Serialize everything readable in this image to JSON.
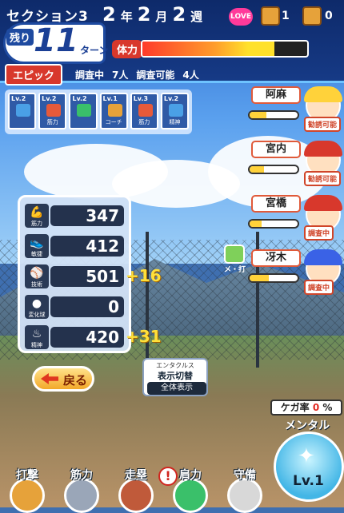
{
  "header": {
    "section": "セクション3",
    "year": "2",
    "year_unit": "年",
    "month": "2",
    "month_unit": "月",
    "week": "2",
    "week_unit": "週",
    "love_badge": "LOVE",
    "chest_1_count": "1",
    "chest_2_count": "0",
    "remaining_label": "残り",
    "turns_value": "11",
    "turns_unit": "ターン",
    "stamina_label": "体力",
    "stamina_fraction": 0.8,
    "epic_label": "エピック",
    "investigating_label": "調査中",
    "investigating_count": "7人",
    "investigatable_label": "調査可能",
    "investigatable_count": "4人"
  },
  "cards": [
    {
      "lv": "Lv.2",
      "name": "",
      "color": "#4aa0e6"
    },
    {
      "lv": "Lv.2",
      "name": "筋力",
      "color": "#e65a3a"
    },
    {
      "lv": "Lv.2",
      "name": "",
      "color": "#3ac06a"
    },
    {
      "lv": "Lv.1",
      "name": "コーチ",
      "color": "#e6a23a"
    },
    {
      "lv": "Lv.3",
      "name": "筋力",
      "color": "#e65a3a"
    },
    {
      "lv": "Lv.2",
      "name": "精神",
      "color": "#4aa0e6"
    }
  ],
  "stats": [
    {
      "icon": "muscle-icon",
      "label": "筋力",
      "value": "347",
      "plus": ""
    },
    {
      "icon": "shoe-icon",
      "label": "敏捷",
      "value": "412",
      "plus": ""
    },
    {
      "icon": "bat-icon",
      "label": "技術",
      "value": "501",
      "plus": "+16"
    },
    {
      "icon": "ball-icon",
      "label": "変化球",
      "value": "0",
      "plus": ""
    },
    {
      "icon": "flame-icon",
      "label": "精神",
      "value": "420",
      "plus": "+31"
    }
  ],
  "back_button": "戻る",
  "entax": {
    "line1": "エンタクルス",
    "line2": "表示切替",
    "line3": "全体表示"
  },
  "characters": [
    {
      "name": "阿麻",
      "bar": 0.35,
      "status": "勧誘可能",
      "hat_color": "#ffd23a"
    },
    {
      "name": "宮内",
      "bar": 0.3,
      "status": "勧誘可能",
      "hat_color": "#d8382c"
    },
    {
      "name": "宮橋",
      "bar": 0.25,
      "status": "調査中",
      "hat_color": "#d8382c"
    },
    {
      "name": "冴木",
      "bar": 0.4,
      "status": "調査中",
      "hat_color": "#3a62e6"
    }
  ],
  "meda_label": "メ・打",
  "injury": {
    "label": "ケガ率",
    "value": "0",
    "unit": "%"
  },
  "mental": {
    "label": "メンタル",
    "level": "Lv.1"
  },
  "actions": [
    {
      "label": "打撃",
      "color": "#e6a23a"
    },
    {
      "label": "筋力",
      "color": "#9aa6b8"
    },
    {
      "label": "走塁",
      "color": "#c05a3a"
    },
    {
      "label": "肩力",
      "color": "#3ac06a"
    },
    {
      "label": "守備",
      "color": "#d8d8d8"
    }
  ],
  "alert_symbol": "!"
}
